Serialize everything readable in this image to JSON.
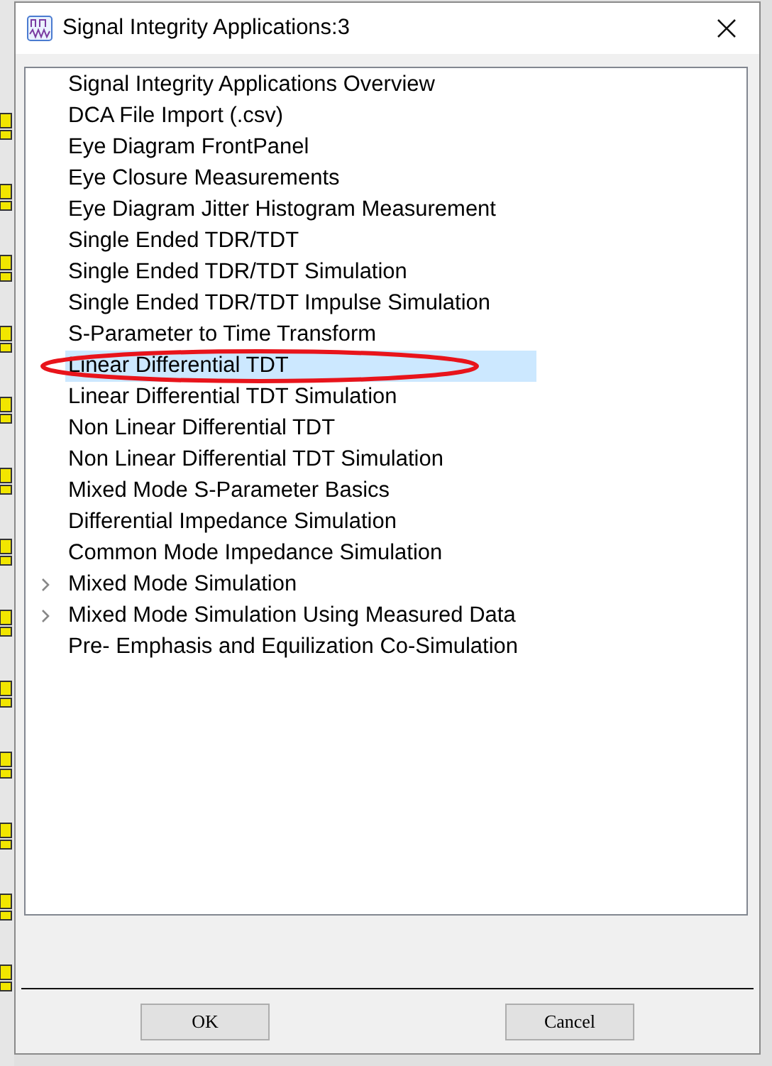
{
  "window": {
    "title": "Signal Integrity Applications:3"
  },
  "tree": {
    "items": [
      {
        "label": "Signal Integrity Applications Overview",
        "kind": "item",
        "selected": false
      },
      {
        "label": "DCA File Import (.csv)",
        "kind": "item",
        "selected": false
      },
      {
        "label": "Eye Diagram FrontPanel",
        "kind": "item",
        "selected": false
      },
      {
        "label": "Eye Closure Measurements",
        "kind": "item",
        "selected": false
      },
      {
        "label": "Eye Diagram Jitter Histogram Measurement",
        "kind": "item",
        "selected": false
      },
      {
        "label": "Single Ended TDR/TDT",
        "kind": "item",
        "selected": false
      },
      {
        "label": "Single Ended TDR/TDT Simulation",
        "kind": "item",
        "selected": false
      },
      {
        "label": "Single Ended TDR/TDT Impulse Simulation",
        "kind": "item",
        "selected": false
      },
      {
        "label": "S-Parameter to Time Transform",
        "kind": "item",
        "selected": false
      },
      {
        "label": "Linear Differential TDT",
        "kind": "item",
        "selected": true,
        "circled": true
      },
      {
        "label": "Linear Differential TDT Simulation",
        "kind": "item",
        "selected": false
      },
      {
        "label": "Non Linear Differential TDT",
        "kind": "item",
        "selected": false
      },
      {
        "label": "Non Linear Differential TDT Simulation",
        "kind": "item",
        "selected": false
      },
      {
        "label": "Mixed Mode S-Parameter Basics",
        "kind": "item",
        "selected": false
      },
      {
        "label": "Differential Impedance Simulation",
        "kind": "item",
        "selected": false
      },
      {
        "label": "Common Mode Impedance Simulation",
        "kind": "item",
        "selected": false
      },
      {
        "label": "Mixed Mode Simulation",
        "kind": "group",
        "expanded": false,
        "selected": false
      },
      {
        "label": "Mixed Mode Simulation Using Measured Data",
        "kind": "group",
        "expanded": false,
        "selected": false
      },
      {
        "label": "Pre- Emphasis and Equilization Co-Simulation",
        "kind": "item",
        "selected": false
      }
    ]
  },
  "buttons": [
    "OK",
    "Cancel"
  ]
}
